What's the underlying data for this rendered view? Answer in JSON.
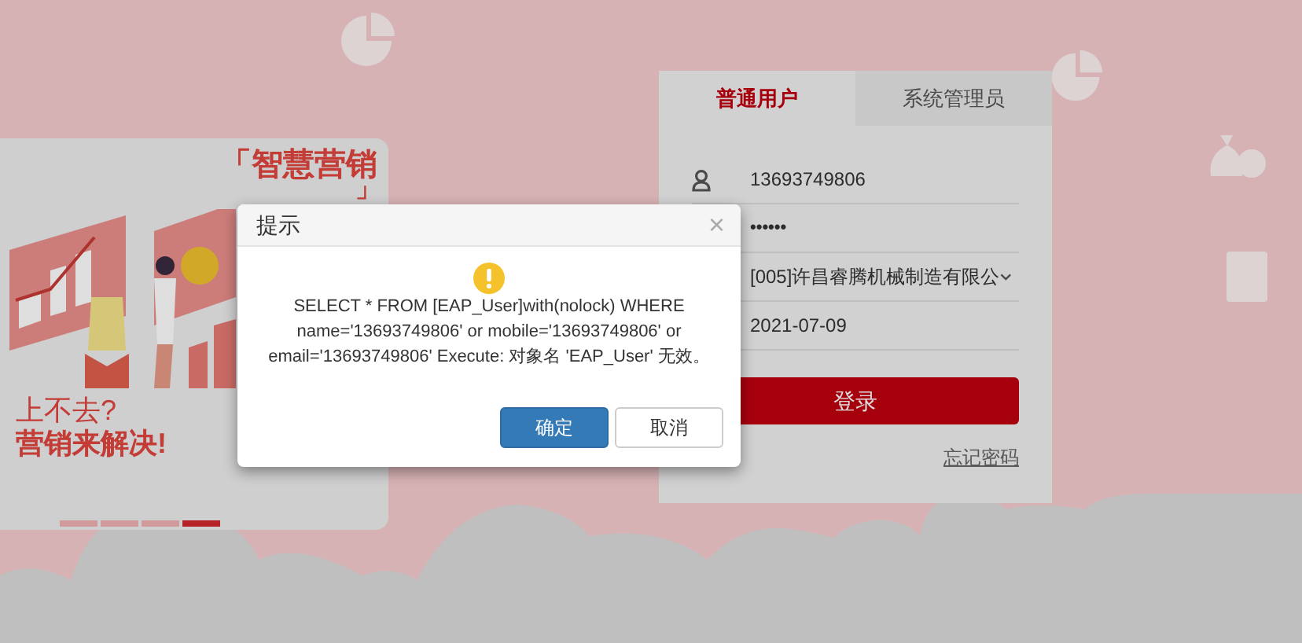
{
  "banner": {
    "title": "「智慧营销",
    "title_end": "」",
    "caption_lines": [
      {
        "text": "上不去?",
        "bold": false
      },
      {
        "text": "营销来解决!",
        "bold": true
      }
    ],
    "slides": [
      {
        "selected": false
      },
      {
        "selected": false
      },
      {
        "selected": false
      },
      {
        "selected": true
      }
    ]
  },
  "login": {
    "tabs": [
      {
        "label": "普通用户",
        "selected": true
      },
      {
        "label": "系统管理员",
        "selected": false
      }
    ],
    "fields": [
      {
        "kind": "text",
        "value": "13693749806"
      },
      {
        "kind": "password",
        "value": "••••••"
      },
      {
        "kind": "select",
        "value": "[005]许昌睿腾机械制造有限公"
      },
      {
        "kind": "date",
        "value": "2021-07-09"
      }
    ],
    "submit": "登录",
    "forgot_link": "忘记密码"
  },
  "dialog": {
    "title": "提示",
    "close": "×",
    "message": "SELECT * FROM [EAP_User]with(nolock) WHERE name='13693749806' or mobile='13693749806' or email='13693749806' Execute: 对象名 'EAP_User' 无效。",
    "buttons": [
      {
        "label": "确定",
        "kind": "primary"
      },
      {
        "label": "取消",
        "kind": "default"
      }
    ]
  }
}
